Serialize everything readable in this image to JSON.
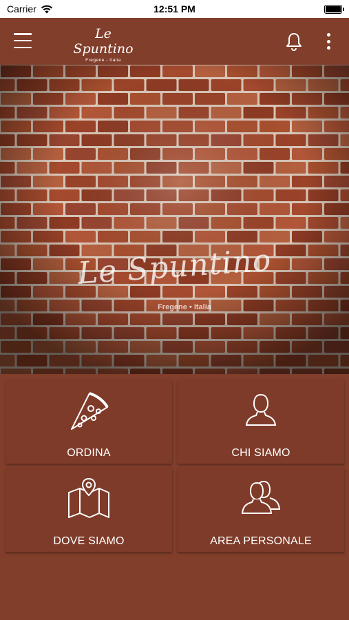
{
  "status_bar": {
    "carrier": "Carrier",
    "time": "12:51 PM"
  },
  "header": {
    "logo_title": "Le Spuntino",
    "logo_subtitle": "Fregene - Italia"
  },
  "hero": {
    "title": "Le Spuntino",
    "subtitle": "Fregene • Italia"
  },
  "tiles": [
    {
      "label": "ORDINA",
      "icon": "pizza-slice-icon"
    },
    {
      "label": "CHI SIAMO",
      "icon": "person-icon"
    },
    {
      "label": "DOVE SIAMO",
      "icon": "map-pin-icon"
    },
    {
      "label": "AREA PERSONALE",
      "icon": "users-icon"
    }
  ],
  "colors": {
    "brand": "#813e2b",
    "tile": "#7f3b29",
    "brick": "#a54a2e"
  }
}
